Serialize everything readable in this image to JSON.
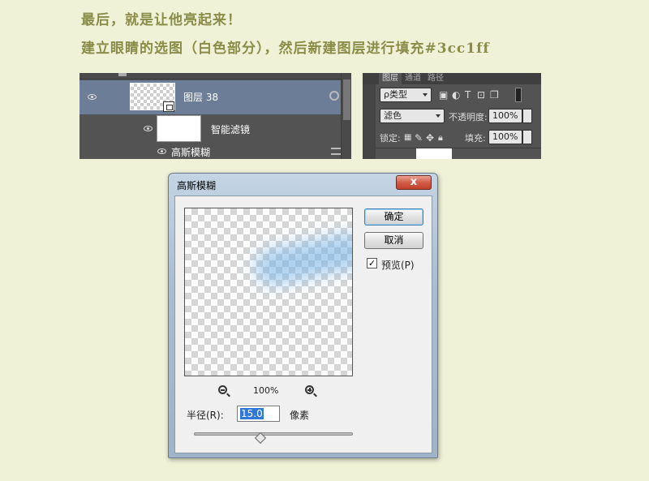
{
  "captions": {
    "line1": "最后，就是让他亮起来！",
    "line2": "建立眼睛的选图（白色部分），然后新建图层进行填充#3cc1ff"
  },
  "layers_panel": {
    "layer_name": "图层 38",
    "smart_filters_label": "智能滤镜",
    "gaussian_blur_label": "高斯模糊"
  },
  "ps_panel": {
    "tabs": [
      "图层",
      "通道",
      "路径"
    ],
    "kind_label": "ρ类型",
    "blend_mode": "滤色",
    "opacity_label": "不透明度:",
    "opacity_value": "100%",
    "lock_label": "锁定:",
    "fill_label": "填充:",
    "fill_value": "100%"
  },
  "dialog": {
    "title": "高斯模糊",
    "close_label": "x",
    "ok_label": "确定",
    "cancel_label": "取消",
    "preview_label": "预览(P)",
    "preview_checked": "✓",
    "zoom_level": "100%",
    "radius_label": "半径(R):",
    "radius_value": "15.0",
    "radius_unit": "像素"
  },
  "colors": {
    "caption": "#8a8c48",
    "background": "#f0f2d8",
    "selected_layer": "#6c7d98",
    "panel": "#535353"
  }
}
